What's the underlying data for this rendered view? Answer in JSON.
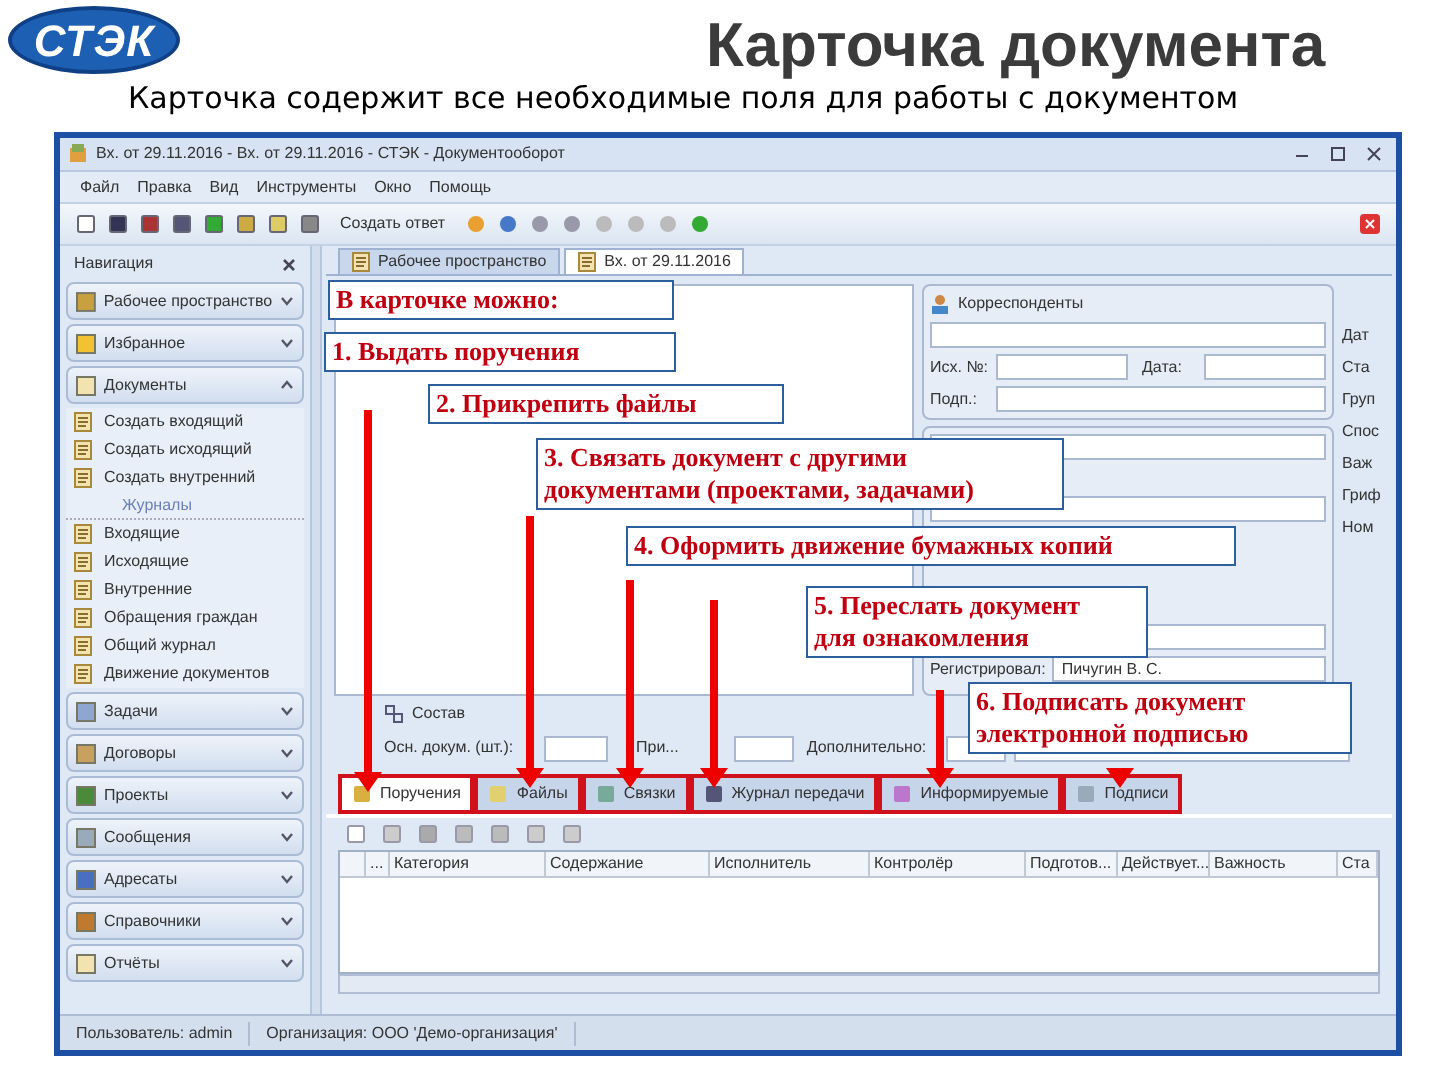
{
  "slide": {
    "logo": "СТЭК",
    "title": "Карточка документа",
    "subtitle": "Карточка содержит все необходимые поля для работы с документом"
  },
  "window": {
    "title": "Вх. от 29.11.2016 - Вх. от 29.11.2016 - СТЭК - Документооборот",
    "menu": [
      "Файл",
      "Правка",
      "Вид",
      "Инструменты",
      "Окно",
      "Помощь"
    ],
    "toolbar_button": "Создать ответ"
  },
  "navigation": {
    "title": "Навигация",
    "sections": [
      {
        "label": "Рабочее пространство",
        "expanded": false
      },
      {
        "label": "Избранное",
        "expanded": false
      },
      {
        "label": "Документы",
        "expanded": true,
        "items": [
          {
            "label": "Создать входящий",
            "kind": "item"
          },
          {
            "label": "Создать исходящий",
            "kind": "item"
          },
          {
            "label": "Создать внутренний",
            "kind": "item"
          },
          {
            "label": "Журналы",
            "kind": "header"
          },
          {
            "label": "Входящие",
            "kind": "item"
          },
          {
            "label": "Исходящие",
            "kind": "item"
          },
          {
            "label": "Внутренние",
            "kind": "item"
          },
          {
            "label": "Обращения граждан",
            "kind": "item"
          },
          {
            "label": "Общий журнал",
            "kind": "item"
          },
          {
            "label": "Движение документов",
            "kind": "item"
          }
        ]
      },
      {
        "label": "Задачи",
        "expanded": false
      },
      {
        "label": "Договоры",
        "expanded": false
      },
      {
        "label": "Проекты",
        "expanded": false
      },
      {
        "label": "Сообщения",
        "expanded": false
      },
      {
        "label": "Адресаты",
        "expanded": false
      },
      {
        "label": "Справочники",
        "expanded": false
      },
      {
        "label": "Отчёты",
        "expanded": false
      }
    ]
  },
  "doc_tabs": [
    {
      "label": "Рабочее пространство",
      "selected": false
    },
    {
      "label": "Вх. от 29.11.2016",
      "selected": true
    }
  ],
  "card": {
    "correspondents": {
      "title": "Корреспонденты",
      "out_number": "Исх. №:",
      "date": "Дата:",
      "signed": "Подп.:"
    },
    "side_labels": [
      "Дат",
      "Ста",
      "Груп",
      "Спос",
      "Важ",
      "Гриф",
      "Ном"
    ],
    "registered_label": "Регистрировал:",
    "registered_value": "Пичугин В. С.",
    "composition": {
      "title": "Состав",
      "main_docs": "Осн. докум. (шт.):",
      "attachments": "При...",
      "extra": "Дополнительно:"
    }
  },
  "bottom_tabs": [
    {
      "label": "Поручения",
      "selected": true
    },
    {
      "label": "Файлы",
      "selected": false
    },
    {
      "label": "Связки",
      "selected": false
    },
    {
      "label": "Журнал передачи",
      "selected": false
    },
    {
      "label": "Информируемые",
      "selected": false
    },
    {
      "label": "Подписи",
      "selected": false
    }
  ],
  "grid": {
    "columns": [
      "...",
      "Категория",
      "Содержание",
      "Исполнитель",
      "Контролёр",
      "Подготов...",
      "Действует...",
      "Важность",
      "Ста"
    ]
  },
  "status_bar": [
    "Пользователь: admin",
    "Организация: ООО 'Демо-организация'"
  ],
  "callouts": [
    "В карточке можно:",
    "1. Выдать поручения",
    "2. Прикрепить файлы",
    "3. Связать документ с другими\nдокументами (проектами, задачами)",
    "4. Оформить движение бумажных копий",
    "5. Переслать документ\nдля ознакомления",
    "6. Подписать документ\nэлектронной подписью"
  ]
}
